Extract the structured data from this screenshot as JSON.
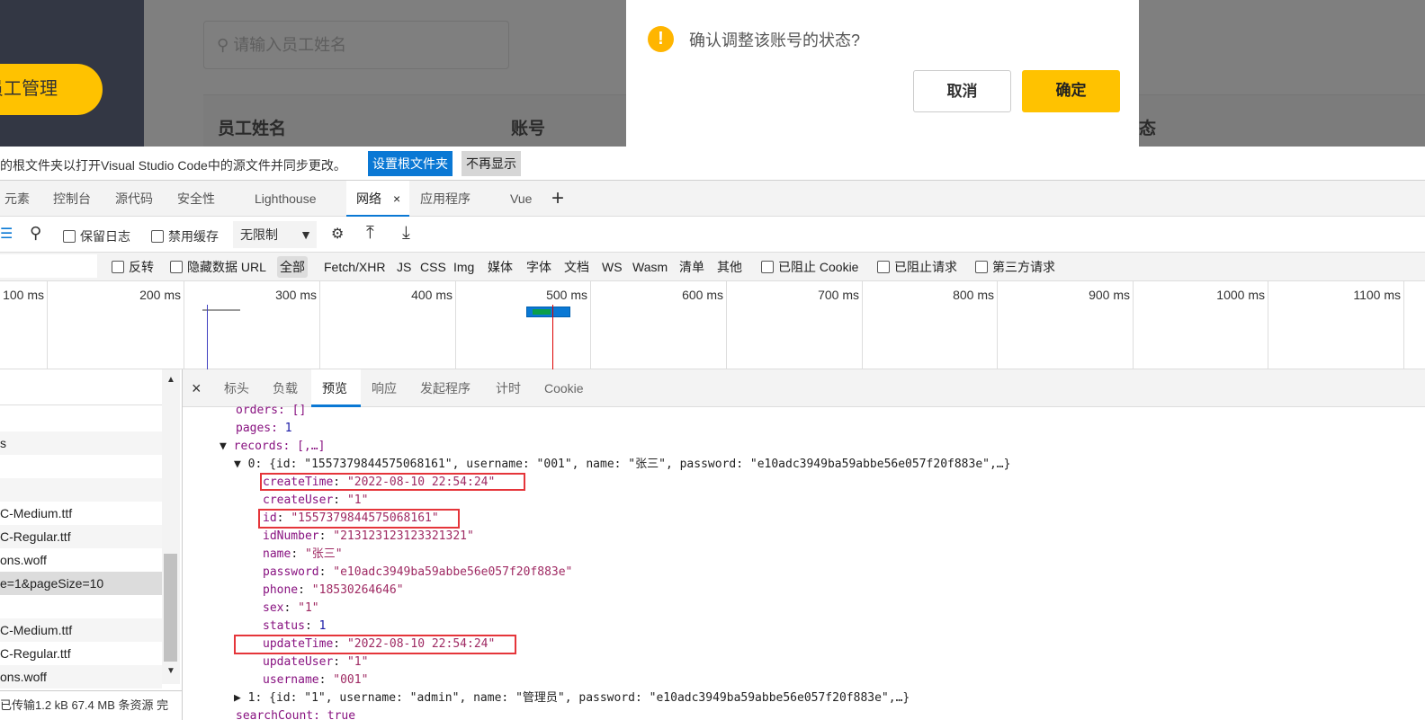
{
  "app": {
    "nav_active": "员工管理",
    "search_placeholder": "请输入员工姓名",
    "columns": [
      "员工姓名",
      "账号",
      "态"
    ]
  },
  "dialog": {
    "message": "确认调整该账号的状态?",
    "cancel": "取消",
    "confirm": "确定",
    "icon": "warning-icon",
    "accent": "#ffc200"
  },
  "banner": {
    "text": "的根文件夹以打开Visual Studio Code中的源文件并同步更改。",
    "set_root": "设置根文件夹",
    "dismiss": "不再显示"
  },
  "devtools": {
    "tabs": [
      "元素",
      "控制台",
      "源代码",
      "安全性",
      "Lighthouse",
      "网络",
      "应用程序",
      "Vue"
    ],
    "active_tab": "网络",
    "toolbar": {
      "preserve_log": "保留日志",
      "disable_cache": "禁用缓存",
      "throttle": "无限制"
    },
    "filter": {
      "invert": "反转",
      "hide_data_url": "隐藏数据 URL",
      "types": [
        "全部",
        "Fetch/XHR",
        "JS",
        "CSS",
        "Img",
        "媒体",
        "字体",
        "文档",
        "WS",
        "Wasm",
        "清单",
        "其他"
      ],
      "blocked_cookies": "已阻止 Cookie",
      "blocked_requests": "已阻止请求",
      "third_party": "第三方请求"
    },
    "timeline": [
      "100 ms",
      "200 ms",
      "300 ms",
      "400 ms",
      "500 ms",
      "600 ms",
      "700 ms",
      "800 ms",
      "900 ms",
      "1000 ms",
      "1100 ms"
    ],
    "requests": [
      "",
      "s",
      "",
      "",
      "C-Medium.ttf",
      "C-Regular.ttf",
      "ons.woff",
      "e=1&pageSize=10",
      "",
      "C-Medium.ttf",
      "C-Regular.ttf",
      "ons.woff"
    ],
    "status_bar": "已传输1.2 kB  67.4 MB 条资源  完",
    "detail_tabs": [
      "标头",
      "负载",
      "预览",
      "响应",
      "发起程序",
      "计时",
      "Cookie"
    ],
    "active_detail_tab": "预览",
    "preview": {
      "orders": "orders: []",
      "pages_key": "pages: ",
      "pages_val": "1",
      "records": "records: [,…]",
      "rec0": "0: {id: \"1557379844575068161\", username: \"001\", name: \"张三\", password: \"e10adc3949ba59abbe56e057f20f883e\",…}",
      "fields": [
        {
          "k": "createTime",
          "v": "\"2022-08-10 22:54:24\""
        },
        {
          "k": "createUser",
          "v": "\"1\""
        },
        {
          "k": "id",
          "v": "\"1557379844575068161\""
        },
        {
          "k": "idNumber",
          "v": "\"213123123123321321\""
        },
        {
          "k": "name",
          "v": "\"张三\""
        },
        {
          "k": "password",
          "v": "\"e10adc3949ba59abbe56e057f20f883e\""
        },
        {
          "k": "phone",
          "v": "\"18530264646\""
        },
        {
          "k": "sex",
          "v": "\"1\""
        },
        {
          "k": "status",
          "v": "1"
        },
        {
          "k": "updateTime",
          "v": "\"2022-08-10 22:54:24\""
        },
        {
          "k": "updateUser",
          "v": "\"1\""
        },
        {
          "k": "username",
          "v": "\"001\""
        }
      ],
      "rec1": "1: {id: \"1\", username: \"admin\", name: \"管理员\", password: \"e10adc3949ba59abbe56e057f20f883e\",…}",
      "searchCount": "searchCount: true"
    }
  }
}
